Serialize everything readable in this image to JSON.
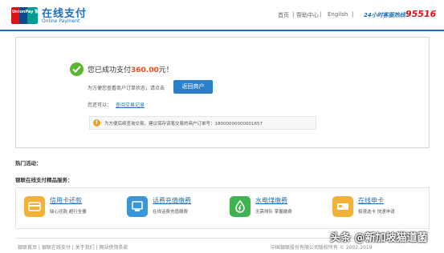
{
  "header": {
    "logo_text": "UnionPay 银联",
    "brand_title": "在线支付",
    "brand_subtitle": "Online Payment",
    "nav": [
      "首页",
      "帮助中心",
      "English"
    ],
    "hotline_label": "24小时客服热线",
    "hotline_number": "95516",
    "colors": {
      "primary": "#1e6fb7",
      "brand_red": "#d7141a",
      "brand_teal": "#089b8f"
    }
  },
  "result": {
    "success_prefix": "您已成功支付",
    "amount": "360.00",
    "success_suffix": "元！",
    "hint": "为方便您查看商户订单状态，请点击",
    "return_button": "返回商户",
    "view_prefix": "您还可以：",
    "view_link": "查阅交易记录",
    "notice": "为方便后续查询交易，建议保存该笔交易的商户订单号：18000000000001657"
  },
  "hot": {
    "label": "热门活动："
  },
  "featured": {
    "title": "银联在线支付精品服务：",
    "items": [
      {
        "title": "信用卡还款",
        "subtitle": "缺心还款 超行全覆",
        "icon": "credit-card-icon",
        "color": "#f2b23a"
      },
      {
        "title": "话费充值缴费",
        "subtitle": "在线话费充值缴费",
        "icon": "phone-icon",
        "color": "#3a96d8"
      },
      {
        "title": "水电煤缴费",
        "subtitle": "无需排队 掌握缴费",
        "icon": "utility-icon",
        "color": "#3fb34f"
      },
      {
        "title": "在线申卡",
        "subtitle": "极速选卡 快速申请",
        "icon": "card-apply-icon",
        "color": "#f2b23a"
      }
    ]
  },
  "footer": {
    "links": "银联首页 | 银联在线支付 | 关于我们 | 网站使用条款",
    "copyright": "中国银联股份有限公司版权所有 © 2002-2019"
  },
  "watermark": "头条 @新加坡猫道菌"
}
